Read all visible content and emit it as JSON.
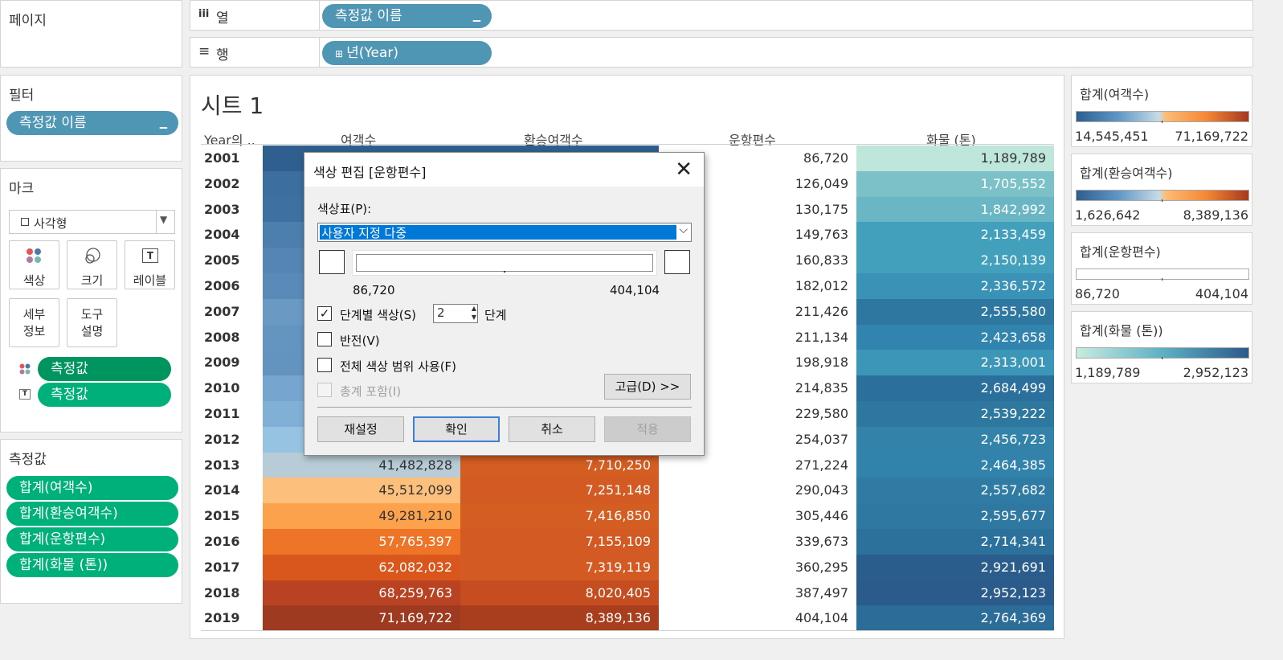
{
  "left": {
    "pages_title": "페이지",
    "filters_title": "필터",
    "filter_pill": "측정값 이름",
    "marks_title": "마크",
    "mark_type": "사각형",
    "mark_cards": [
      {
        "label": "색상",
        "icon": "color-dots-icon"
      },
      {
        "label": "크기",
        "icon": "size-icon"
      },
      {
        "label": "레이블",
        "icon": "text-label-icon"
      },
      {
        "label": "세부\n정보",
        "icon": ""
      },
      {
        "label": "도구\n설명",
        "icon": ""
      }
    ],
    "mark_pills": [
      "측정값",
      "측정값"
    ],
    "measures_title": "측정값",
    "measure_pills": [
      "합계(여객수)",
      "합계(환승여객수)",
      "합계(운항편수)",
      "합계(화물 (톤))"
    ]
  },
  "shelves": {
    "columns_icon": "iii",
    "columns_label": "열",
    "columns_pill": "측정값 이름",
    "rows_icon": "≡",
    "rows_label": "행",
    "rows_pill": "년(Year)"
  },
  "sheet": {
    "title": "시트 1",
    "headers": [
      "Year의 ..",
      "여객수",
      "환승여객수",
      "운항편수",
      "화물 (톤)"
    ],
    "rows": [
      {
        "year": "2001",
        "passengers": "",
        "transfer": "",
        "flights": "86,720",
        "cargo": "1,189,789"
      },
      {
        "year": "2002",
        "passengers": "",
        "transfer": "",
        "flights": "126,049",
        "cargo": "1,705,552"
      },
      {
        "year": "2003",
        "passengers": "",
        "transfer": "",
        "flights": "130,175",
        "cargo": "1,842,992"
      },
      {
        "year": "2004",
        "passengers": "",
        "transfer": "",
        "flights": "149,763",
        "cargo": "2,133,459"
      },
      {
        "year": "2005",
        "passengers": "",
        "transfer": "",
        "flights": "160,833",
        "cargo": "2,150,139"
      },
      {
        "year": "2006",
        "passengers": "",
        "transfer": "",
        "flights": "182,012",
        "cargo": "2,336,572"
      },
      {
        "year": "2007",
        "passengers": "",
        "transfer": "",
        "flights": "211,426",
        "cargo": "2,555,580"
      },
      {
        "year": "2008",
        "passengers": "",
        "transfer": "",
        "flights": "211,134",
        "cargo": "2,423,658"
      },
      {
        "year": "2009",
        "passengers": "",
        "transfer": "",
        "flights": "198,918",
        "cargo": "2,313,001"
      },
      {
        "year": "2010",
        "passengers": "",
        "transfer": "",
        "flights": "214,835",
        "cargo": "2,684,499"
      },
      {
        "year": "2011",
        "passengers": "",
        "transfer": "",
        "flights": "229,580",
        "cargo": "2,539,222"
      },
      {
        "year": "2012",
        "passengers": "",
        "transfer": "",
        "flights": "254,037",
        "cargo": "2,456,723"
      },
      {
        "year": "2013",
        "passengers": "41,482,828",
        "transfer": "7,710,250",
        "flights": "271,224",
        "cargo": "2,464,385"
      },
      {
        "year": "2014",
        "passengers": "45,512,099",
        "transfer": "7,251,148",
        "flights": "290,043",
        "cargo": "2,557,682"
      },
      {
        "year": "2015",
        "passengers": "49,281,210",
        "transfer": "7,416,850",
        "flights": "305,446",
        "cargo": "2,595,677"
      },
      {
        "year": "2016",
        "passengers": "57,765,397",
        "transfer": "7,155,109",
        "flights": "339,673",
        "cargo": "2,714,341"
      },
      {
        "year": "2017",
        "passengers": "62,082,032",
        "transfer": "7,319,119",
        "flights": "360,295",
        "cargo": "2,921,691"
      },
      {
        "year": "2018",
        "passengers": "68,259,763",
        "transfer": "8,020,405",
        "flights": "387,497",
        "cargo": "2,952,123"
      },
      {
        "year": "2019",
        "passengers": "71,169,722",
        "transfer": "8,389,136",
        "flights": "404,104",
        "cargo": "2,764,369"
      }
    ],
    "colors": {
      "passengers": [
        "#2f5f8f",
        "#3c6ea0",
        "#3e70a2",
        "#4c7eae",
        "#5585b4",
        "#5a8ab8",
        "#6a99c4",
        "#6495c1",
        "#6394c0",
        "#76a6cf",
        "#80b0d6",
        "#97c3e2",
        "#b7ccd6",
        "#fdc07c",
        "#fca24c",
        "#ee7428",
        "#d9561c",
        "#b84221",
        "#9e3a1f"
      ],
      "transfer": [
        "#2f5f8f",
        "#2f5f8f",
        "#2f5f8f",
        "#2f5f8f",
        "#2f5f8f",
        "#2f5f8f",
        "#2f5f8f",
        "#2f5f8f",
        "#2f5f8f",
        "#2f5f8f",
        "#2f5f8f",
        "#2f5f8f",
        "#d45d22",
        "#d35a22",
        "#d45d22",
        "#d35a22",
        "#d35a22",
        "#c54d1f",
        "#a83e1e"
      ],
      "cargo": [
        "#bfe6da",
        "#7cc1c8",
        "#6bb6c4",
        "#42a0bd",
        "#42a0bd",
        "#3a93b6",
        "#2e77a0",
        "#3184ad",
        "#3c96b8",
        "#2b6f9c",
        "#2e789f",
        "#3382aa",
        "#3183ab",
        "#2f7ba3",
        "#2f78a1",
        "#2c709c",
        "#2a5d8c",
        "#2a5b8a",
        "#2c6c98"
      ]
    }
  },
  "legends": [
    {
      "title": "합계(여객수)",
      "min": "14,545,451",
      "max": "71,169,722",
      "gradient": "linear-gradient(to right,#2e5e8e,#5f96c5,#c6dbe6 48%,#fdbc75 52%,#f48636,#a6381e)"
    },
    {
      "title": "합계(환승여객수)",
      "min": "1,626,642",
      "max": "8,389,136",
      "gradient": "linear-gradient(to right,#2e5e8e,#5f96c5,#c6dbe6 48%,#fdbc75 52%,#f48636,#a6381e)"
    },
    {
      "title": "합계(운항편수)",
      "min": "86,720",
      "max": "404,104",
      "gradient": "linear-gradient(to right,#ffffff,#ffffff)"
    },
    {
      "title": "합계(화물 (톤))",
      "min": "1,189,789",
      "max": "2,952,123",
      "gradient": "linear-gradient(to right,#c8ebe0,#5eb0c4,#2c5a8a)"
    }
  ],
  "dialog": {
    "title": "색상 편집 [운항편수]",
    "palette_label": "색상표(P):",
    "palette_value": "사용자 지정 다중",
    "range_min": "86,720",
    "range_max": "404,104",
    "stepped_label": "단계별 색상(S)",
    "steps_value": "2",
    "steps_unit": "단계",
    "reverse_label": "반전(V)",
    "full_range_label": "전체 색상 범위 사용(F)",
    "include_totals_label": "총계 포함(I)",
    "advanced_label": "고급(D) >>",
    "reset_label": "재설정",
    "ok_label": "확인",
    "cancel_label": "취소",
    "apply_label": "적용"
  }
}
